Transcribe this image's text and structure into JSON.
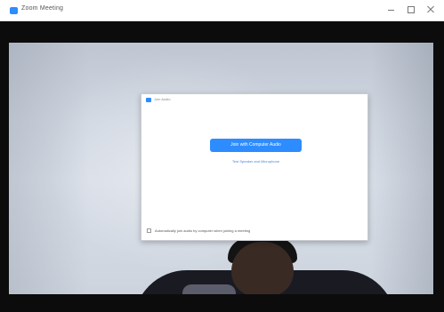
{
  "window": {
    "title": "Zoom Meeting",
    "icon": "zoom-app-icon",
    "controls": [
      "minimize-icon",
      "maximize-icon",
      "close-icon"
    ]
  },
  "dialog": {
    "title": "Join Audio",
    "join_button_label": "Join with Computer Audio",
    "test_link": "Test Speaker and Microphone",
    "auto_join_label": "Automatically join audio by computer when joining a meeting",
    "auto_join_checked": false
  },
  "footer": {
    "text": ""
  },
  "colors": {
    "accent": "#2d8cff",
    "meeting_background": "#0c0c0c",
    "dialog_background": "#ffffff"
  }
}
